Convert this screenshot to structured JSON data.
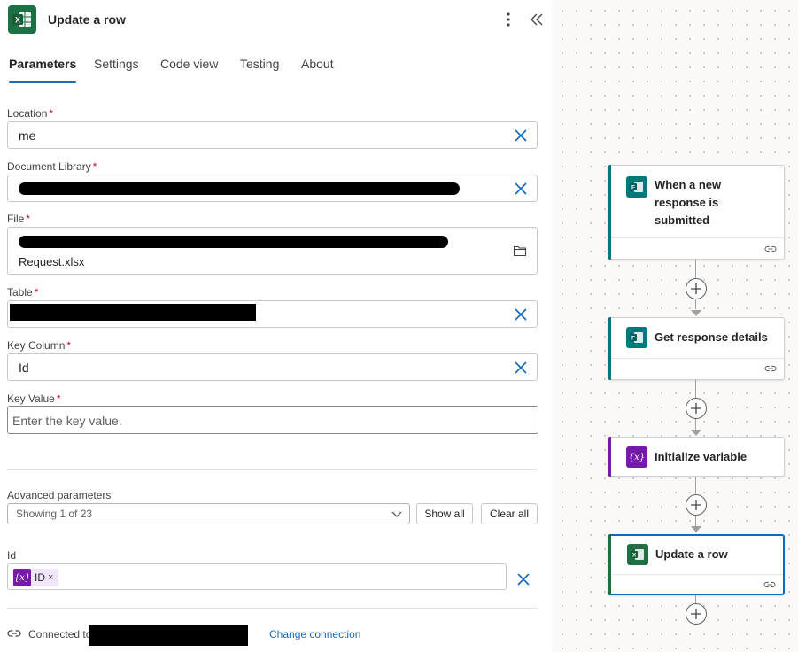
{
  "panel": {
    "title": "Update a row",
    "tabs": [
      "Parameters",
      "Settings",
      "Code view",
      "Testing",
      "About"
    ],
    "fields": {
      "location": {
        "label": "Location",
        "value": "me"
      },
      "document_library": {
        "label": "Document Library"
      },
      "file": {
        "label": "File",
        "value_line2": "Request.xlsx"
      },
      "table": {
        "label": "Table"
      },
      "key_column": {
        "label": "Key Column",
        "value": "Id"
      },
      "key_value": {
        "label": "Key Value",
        "placeholder": "Enter the key value."
      }
    },
    "required_mark": "*",
    "advanced": {
      "label": "Advanced parameters",
      "selected": "Showing 1 of 23",
      "show_all": "Show all",
      "clear_all": "Clear all"
    },
    "id_param": {
      "label": "Id",
      "token_icon": "{x}",
      "token_label": "ID",
      "token_remove": "×"
    },
    "connection": {
      "prefix": "Connected to",
      "change": "Change connection"
    }
  },
  "canvas": {
    "nodes": [
      {
        "title": "When a new response is submitted",
        "icon": "forms-icon",
        "accent": "#03787c"
      },
      {
        "title": "Get response details",
        "icon": "forms-icon",
        "accent": "#03787c"
      },
      {
        "title": "Initialize variable",
        "icon": "variable-icon",
        "icon_text": "{x}",
        "accent": "#7719aa"
      },
      {
        "title": "Update a row",
        "icon": "excel-icon",
        "accent": "#1d7044"
      }
    ]
  },
  "colors": {
    "excel": "#1d7044",
    "forms": "#03787c",
    "variable": "#7719aa",
    "selected": "#0f6cbd"
  }
}
